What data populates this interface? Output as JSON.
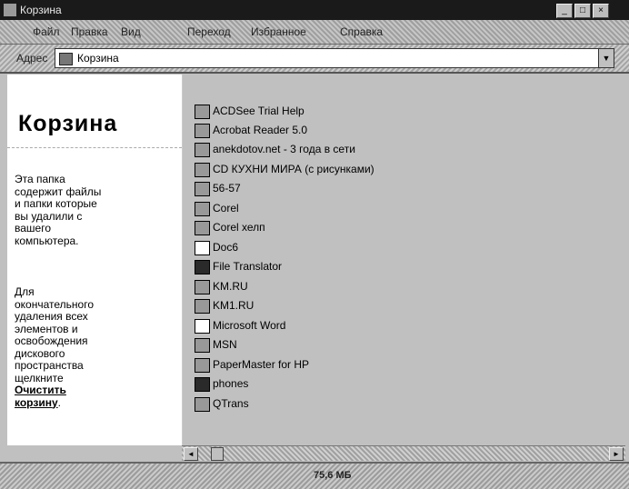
{
  "window": {
    "title": "Корзина"
  },
  "menu": [
    {
      "label": "Файл"
    },
    {
      "label": "Правка"
    },
    {
      "label": "Вид"
    },
    {
      "label": "Переход"
    },
    {
      "label": "Избранное"
    },
    {
      "label": "Справка"
    }
  ],
  "address": {
    "label": "Адрес",
    "value": "Корзина"
  },
  "left_pane": {
    "title": "Корзина",
    "description": "Эта папка\nсодержит файлы\nи папки которые\nвы удалили с\nвашего\nкомпьютера.",
    "instruction": "Для\nокончательного\nудаления всех\nэлементов и\nосвобождения\nдискового\nпространства\nщелкните",
    "empty_link": "Очистить\nкорзину",
    "period": "."
  },
  "files": [
    {
      "name": "ACDSee Trial Help",
      "icon": "help-file-icon"
    },
    {
      "name": "Acrobat Reader 5.0",
      "icon": "acrobat-icon"
    },
    {
      "name": "anekdotov.net - 3 года в сети",
      "icon": "internet-shortcut-icon"
    },
    {
      "name": "CD КУХНИ МИРА (с рисунками)",
      "icon": "folder-icon"
    },
    {
      "name": "56-57",
      "icon": "folder-icon"
    },
    {
      "name": "Corel",
      "icon": "folder-icon"
    },
    {
      "name": "Corel хелп",
      "icon": "folder-icon"
    },
    {
      "name": "Doc6",
      "icon": "document-icon"
    },
    {
      "name": "File Translator",
      "icon": "program-icon"
    },
    {
      "name": "KM.RU",
      "icon": "km-icon"
    },
    {
      "name": "KM1.RU",
      "icon": "km-icon"
    },
    {
      "name": "Microsoft Word",
      "icon": "word-icon"
    },
    {
      "name": "MSN",
      "icon": "msn-icon"
    },
    {
      "name": "PaperMaster for HP",
      "icon": "program-icon"
    },
    {
      "name": "phones",
      "icon": "folder-icon"
    },
    {
      "name": "QTrans",
      "icon": "program-icon"
    }
  ],
  "status": {
    "text": "75,6 МБ"
  }
}
